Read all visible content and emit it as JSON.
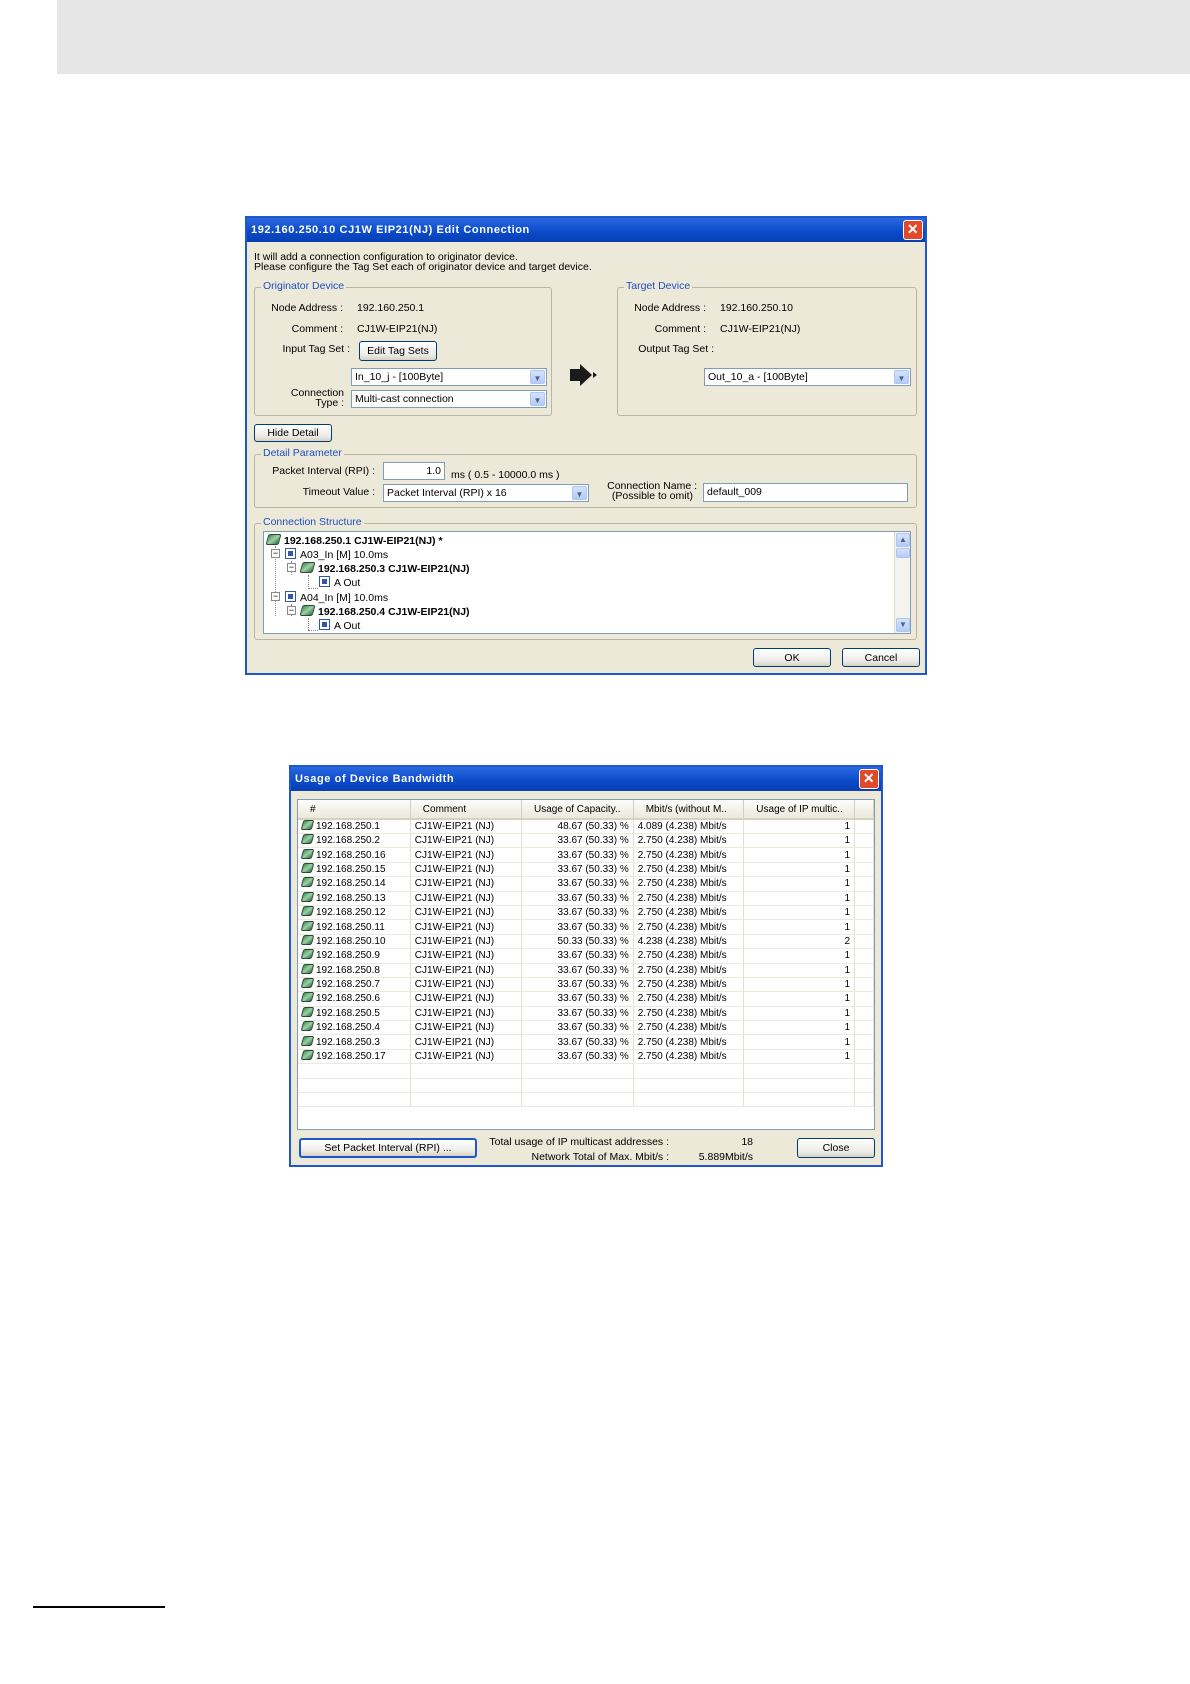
{
  "edit_connection": {
    "title": "192.160.250.10 CJ1W  EIP21(NJ) Edit Connection",
    "intro_line1": "It will add a connection configuration to originator device.",
    "intro_line2": "Please configure the Tag Set each of originator device and target device.",
    "originator": {
      "group_title": "Originator Device",
      "node_address_label": "Node Address :",
      "node_address": "192.160.250.1",
      "comment_label": "Comment :",
      "comment": "CJ1W-EIP21(NJ)",
      "input_tag_set_label": "Input Tag Set :",
      "edit_tag_sets_label": "Edit Tag Sets",
      "tag_set_value": "In_10_j - [100Byte]",
      "connection_type_label_1": "Connection",
      "connection_type_label_2": "Type :",
      "connection_type_value": "Multi-cast connection"
    },
    "target": {
      "group_title": "Target Device",
      "node_address_label": "Node Address :",
      "node_address": "192.160.250.10",
      "comment_label": "Comment :",
      "comment": "CJ1W-EIP21(NJ)",
      "output_tag_set_label": "Output Tag Set :",
      "tag_set_value": "Out_10_a - [100Byte]"
    },
    "hide_detail_label": "Hide Detail",
    "detail": {
      "group_title": "Detail Parameter",
      "packet_interval_label": "Packet Interval (RPI) :",
      "packet_interval_value": "1.0",
      "packet_interval_range": "ms ( 0.5 - 10000.0 ms )",
      "timeout_label": "Timeout Value :",
      "timeout_value": "Packet Interval (RPI) x 16",
      "connection_name_label_1": "Connection Name :",
      "connection_name_label_2": "(Possible to omit)",
      "connection_name_value": "default_009"
    },
    "structure": {
      "group_title": "Connection Structure",
      "nodes": [
        "192.168.250.1  CJ1W-EIP21(NJ) *",
        "A03_In  [M] 10.0ms",
        "192.168.250.3  CJ1W-EIP21(NJ)",
        "A Out",
        "A04_In  [M] 10.0ms",
        "192.168.250.4  CJ1W-EIP21(NJ)",
        "A Out"
      ]
    },
    "ok_label": "OK",
    "cancel_label": "Cancel"
  },
  "bandwidth": {
    "title": "Usage of Device Bandwidth",
    "columns": [
      "#",
      "Comment",
      "Usage of Capacity..",
      "Mbit/s (without M..",
      "Usage of IP multic.."
    ],
    "rows": [
      [
        "192.168.250.1",
        "CJ1W-EIP21 (NJ)",
        "48.67 (50.33) %",
        "4.089 (4.238) Mbit/s",
        "1"
      ],
      [
        "192.168.250.2",
        "CJ1W-EIP21 (NJ)",
        "33.67 (50.33) %",
        "2.750 (4.238) Mbit/s",
        "1"
      ],
      [
        "192.168.250.16",
        "CJ1W-EIP21 (NJ)",
        "33.67 (50.33) %",
        "2.750 (4.238) Mbit/s",
        "1"
      ],
      [
        "192.168.250.15",
        "CJ1W-EIP21 (NJ)",
        "33.67 (50.33) %",
        "2.750 (4.238) Mbit/s",
        "1"
      ],
      [
        "192.168.250.14",
        "CJ1W-EIP21 (NJ)",
        "33.67 (50.33) %",
        "2.750 (4.238) Mbit/s",
        "1"
      ],
      [
        "192.168.250.13",
        "CJ1W-EIP21 (NJ)",
        "33.67 (50.33) %",
        "2.750 (4.238) Mbit/s",
        "1"
      ],
      [
        "192.168.250.12",
        "CJ1W-EIP21 (NJ)",
        "33.67 (50.33) %",
        "2.750 (4.238) Mbit/s",
        "1"
      ],
      [
        "192.168.250.11",
        "CJ1W-EIP21 (NJ)",
        "33.67 (50.33) %",
        "2.750 (4.238) Mbit/s",
        "1"
      ],
      [
        "192.168.250.10",
        "CJ1W-EIP21 (NJ)",
        "50.33 (50.33) %",
        "4.238 (4.238) Mbit/s",
        "2"
      ],
      [
        "192.168.250.9",
        "CJ1W-EIP21 (NJ)",
        "33.67 (50.33) %",
        "2.750 (4.238) Mbit/s",
        "1"
      ],
      [
        "192.168.250.8",
        "CJ1W-EIP21 (NJ)",
        "33.67 (50.33) %",
        "2.750 (4.238) Mbit/s",
        "1"
      ],
      [
        "192.168.250.7",
        "CJ1W-EIP21 (NJ)",
        "33.67 (50.33) %",
        "2.750 (4.238) Mbit/s",
        "1"
      ],
      [
        "192.168.250.6",
        "CJ1W-EIP21 (NJ)",
        "33.67 (50.33) %",
        "2.750 (4.238) Mbit/s",
        "1"
      ],
      [
        "192.168.250.5",
        "CJ1W-EIP21 (NJ)",
        "33.67 (50.33) %",
        "2.750 (4.238) Mbit/s",
        "1"
      ],
      [
        "192.168.250.4",
        "CJ1W-EIP21 (NJ)",
        "33.67 (50.33) %",
        "2.750 (4.238) Mbit/s",
        "1"
      ],
      [
        "192.168.250.3",
        "CJ1W-EIP21 (NJ)",
        "33.67 (50.33) %",
        "2.750 (4.238) Mbit/s",
        "1"
      ],
      [
        "192.168.250.17",
        "CJ1W-EIP21 (NJ)",
        "33.67 (50.33) %",
        "2.750 (4.238) Mbit/s",
        "1"
      ]
    ],
    "set_packet_interval_label": "Set Packet Interval (RPI) ...",
    "total_multicast_label": "Total usage of IP multicast addresses :",
    "total_multicast_value": "18",
    "network_total_label": "Network Total of Max. Mbit/s :",
    "network_total_value": "5.889Mbit/s",
    "close_label": "Close"
  }
}
